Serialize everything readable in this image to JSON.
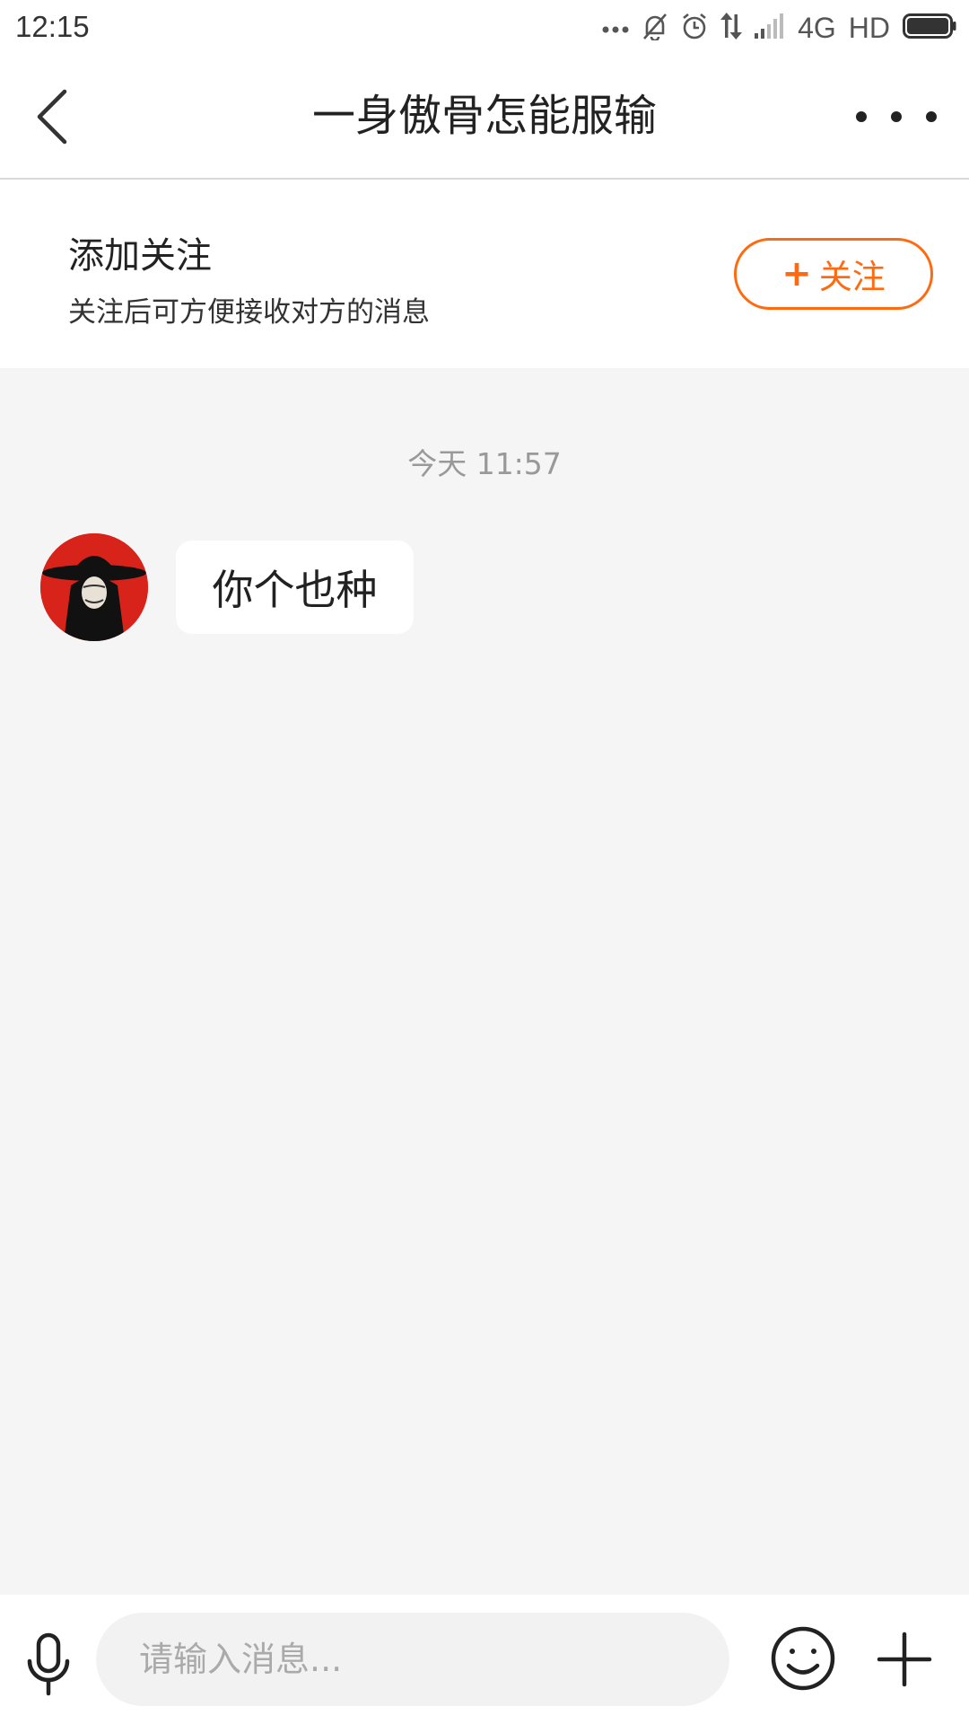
{
  "status_bar": {
    "time": "12:15",
    "network": "4G",
    "hd": "HD",
    "icons": [
      "more-dots-icon",
      "bell-muted-icon",
      "alarm-icon",
      "data-transfer-icon",
      "signal-icon",
      "battery-icon"
    ]
  },
  "header": {
    "title": "一身傲骨怎能服输",
    "back_icon": "chevron-left-icon",
    "more_icon": "more-horizontal-icon"
  },
  "follow_banner": {
    "title": "添加关注",
    "subtitle": "关注后可方便接收对方的消息",
    "button_plus": "+",
    "button_label": "关注"
  },
  "chat": {
    "timestamp": "今天 11:57",
    "messages": [
      {
        "sender": "other",
        "text": "你个也种"
      }
    ]
  },
  "input_bar": {
    "placeholder": "请输入消息...",
    "icons": [
      "microphone-icon",
      "emoji-icon",
      "plus-icon"
    ]
  },
  "colors": {
    "accent": "#ff6a10",
    "background": "#f5f5f5",
    "avatar_bg": "#d8231b"
  }
}
